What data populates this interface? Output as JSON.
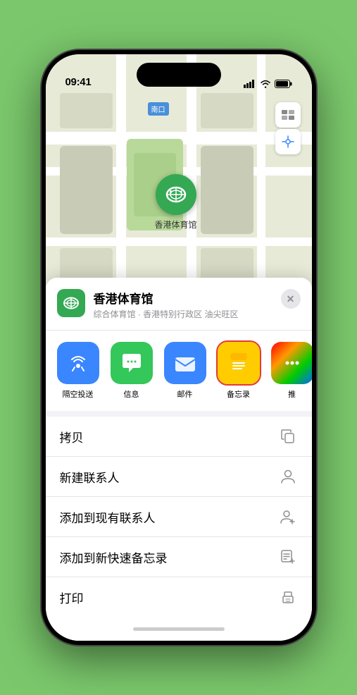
{
  "status_bar": {
    "time": "09:41",
    "signal_bars": "signal",
    "wifi": "wifi",
    "battery": "battery"
  },
  "map": {
    "label": "南口",
    "controls": {
      "map_type": "🗺",
      "location": "⌖"
    }
  },
  "venue_pin": {
    "name": "香港体育馆"
  },
  "bottom_sheet": {
    "venue_name": "香港体育馆",
    "venue_desc": "综合体育馆 · 香港特别行政区 油尖旺区",
    "close_label": "✕"
  },
  "share_row": {
    "items": [
      {
        "id": "airdrop",
        "label": "隔空投送",
        "bg": "airdrop"
      },
      {
        "id": "messages",
        "label": "信息",
        "bg": "messages"
      },
      {
        "id": "mail",
        "label": "邮件",
        "bg": "mail"
      },
      {
        "id": "notes",
        "label": "备忘录",
        "bg": "notes",
        "selected": true
      },
      {
        "id": "more",
        "label": "推",
        "bg": "more"
      }
    ]
  },
  "action_rows": [
    {
      "id": "copy",
      "label": "拷贝",
      "icon": "copy"
    },
    {
      "id": "new-contact",
      "label": "新建联系人",
      "icon": "person"
    },
    {
      "id": "add-contact",
      "label": "添加到现有联系人",
      "icon": "person-add"
    },
    {
      "id": "add-notes",
      "label": "添加到新快速备忘录",
      "icon": "notes-add"
    },
    {
      "id": "print",
      "label": "打印",
      "icon": "print"
    }
  ],
  "home_indicator": {}
}
